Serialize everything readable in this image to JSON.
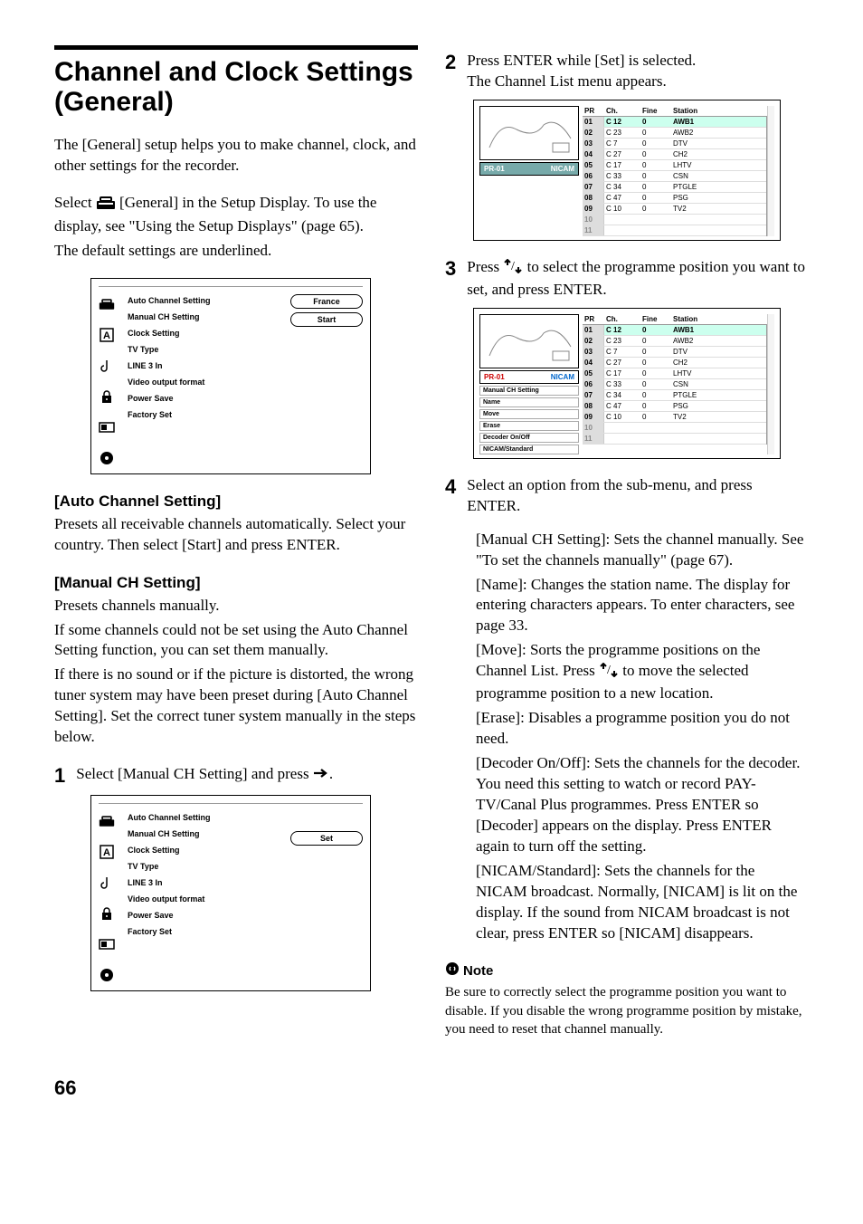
{
  "title": "Channel and Clock Settings (General)",
  "intro1": "The [General] setup helps you to make channel, clock, and other settings for the recorder.",
  "intro2a": "Select ",
  "intro2b": " [General] in the Setup Display. To use the display, see \"Using the Setup Displays\" (page 65).",
  "intro3": "The default settings are underlined.",
  "menu1": {
    "items": [
      "Auto Channel Setting",
      "Manual CH Setting",
      "Clock Setting",
      "TV Type",
      "LINE 3 In",
      "Video output format",
      "Power Save",
      "Factory Set"
    ],
    "buttons": [
      "France",
      "Start"
    ]
  },
  "sec1": {
    "head": "[Auto Channel Setting]",
    "body": "Presets all receivable channels automatically. Select your country. Then select [Start] and press ENTER."
  },
  "sec2": {
    "head": "[Manual CH Setting]",
    "p1": "Presets channels manually.",
    "p2": "If some channels could not be set using the Auto Channel Setting function, you can set them manually.",
    "p3": "If there is no sound or if the picture is distorted, the wrong tuner system may have been preset during [Auto Channel Setting]. Set the correct tuner system manually in the steps below."
  },
  "steps": {
    "s1": {
      "n": "1",
      "t": "Select [Manual CH Setting] and press "
    },
    "s2": {
      "n": "2",
      "t1": "Press ENTER while [Set] is selected.",
      "t2": "The Channel List menu appears."
    },
    "s3": {
      "n": "3",
      "t1": "Press ",
      "t2": " to select the programme position you want to set, and press ENTER."
    },
    "s4": {
      "n": "4",
      "t": "Select an option from the sub-menu, and press ENTER."
    }
  },
  "menu2": {
    "items": [
      "Auto Channel Setting",
      "Manual CH Setting",
      "Clock Setting",
      "TV Type",
      "LINE 3 In",
      "Video output format",
      "Power Save",
      "Factory Set"
    ],
    "button": "Set"
  },
  "ch": {
    "pr": "PR-01",
    "badge": "NICAM",
    "head": [
      "PR",
      "Ch.",
      "Fine",
      "Station"
    ],
    "rows": [
      {
        "pr": "01",
        "ch": "C 12",
        "fine": "0",
        "st": "AWB1",
        "hl": true
      },
      {
        "pr": "02",
        "ch": "C 23",
        "fine": "0",
        "st": "AWB2"
      },
      {
        "pr": "03",
        "ch": "C 7",
        "fine": "0",
        "st": "DTV"
      },
      {
        "pr": "04",
        "ch": "C 27",
        "fine": "0",
        "st": "CH2"
      },
      {
        "pr": "05",
        "ch": "C 17",
        "fine": "0",
        "st": "LHTV"
      },
      {
        "pr": "06",
        "ch": "C 33",
        "fine": "0",
        "st": "CSN"
      },
      {
        "pr": "07",
        "ch": "C 34",
        "fine": "0",
        "st": "PTGLE"
      },
      {
        "pr": "08",
        "ch": "C 47",
        "fine": "0",
        "st": "PSG"
      },
      {
        "pr": "09",
        "ch": "C 10",
        "fine": "0",
        "st": "TV2"
      },
      {
        "pr": "10",
        "ch": "",
        "fine": "",
        "st": "",
        "empty": true
      },
      {
        "pr": "11",
        "ch": "",
        "fine": "",
        "st": "",
        "empty": true
      }
    ],
    "sub": [
      "Manual CH Setting",
      "Name",
      "Move",
      "Erase",
      "Decoder On/Off",
      "NICAM/Standard"
    ]
  },
  "opts": {
    "a": "[Manual CH Setting]: Sets the channel manually. See \"To set the channels manually\" (page 67).",
    "b": "[Name]: Changes the station name. The display for entering characters appears. To enter characters, see page 33.",
    "c1": "[Move]: Sorts the programme positions on the Channel List. Press ",
    "c2": " to move the selected programme position to a new location.",
    "d": "[Erase]: Disables a programme position you do not need.",
    "e": "[Decoder On/Off]: Sets the channels for the decoder. You need this setting to watch or record PAY-TV/Canal Plus programmes. Press ENTER so [Decoder] appears on the display. Press ENTER again to turn off the setting.",
    "f": "[NICAM/Standard]: Sets the channels for the NICAM broadcast. Normally, [NICAM] is lit on the display. If the sound from NICAM broadcast is not clear, press ENTER so [NICAM] disappears."
  },
  "note": {
    "head": "Note",
    "body": "Be sure to correctly select the programme position you want to disable. If you disable the wrong programme position by mistake, you need to reset that channel manually."
  },
  "pageNum": "66"
}
